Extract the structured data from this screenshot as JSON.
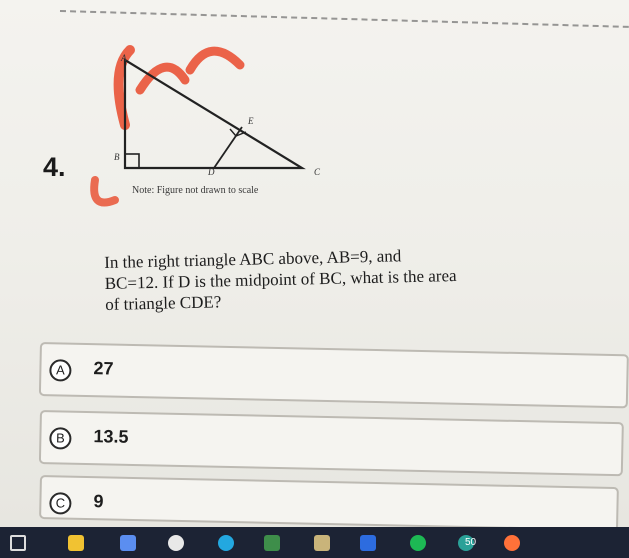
{
  "question": {
    "number": "4.",
    "text_line1": "In the right triangle ABC above, AB=9, and",
    "text_line2": "BC=12. If D is the midpoint of BC, what is the area",
    "text_line3": "of triangle CDE?"
  },
  "figure": {
    "points": {
      "A": "A",
      "B": "B",
      "C": "C",
      "D": "D",
      "E": "E"
    },
    "note": "Note: Figure not drawn to scale"
  },
  "choices": [
    {
      "letter": "A",
      "value": "27"
    },
    {
      "letter": "B",
      "value": "13.5"
    },
    {
      "letter": "C",
      "value": "9"
    }
  ],
  "taskbar": {
    "icons": [
      "search-icon",
      "folder-icon",
      "app-icon",
      "chrome-icon",
      "edge-icon",
      "store-icon",
      "app-icon-2",
      "zoom-icon",
      "spotify-icon",
      "app-icon-3",
      "firefox-icon"
    ],
    "badge": "50"
  },
  "colors": {
    "annotation": "#e94a2b",
    "taskbar": "#1c2334"
  }
}
